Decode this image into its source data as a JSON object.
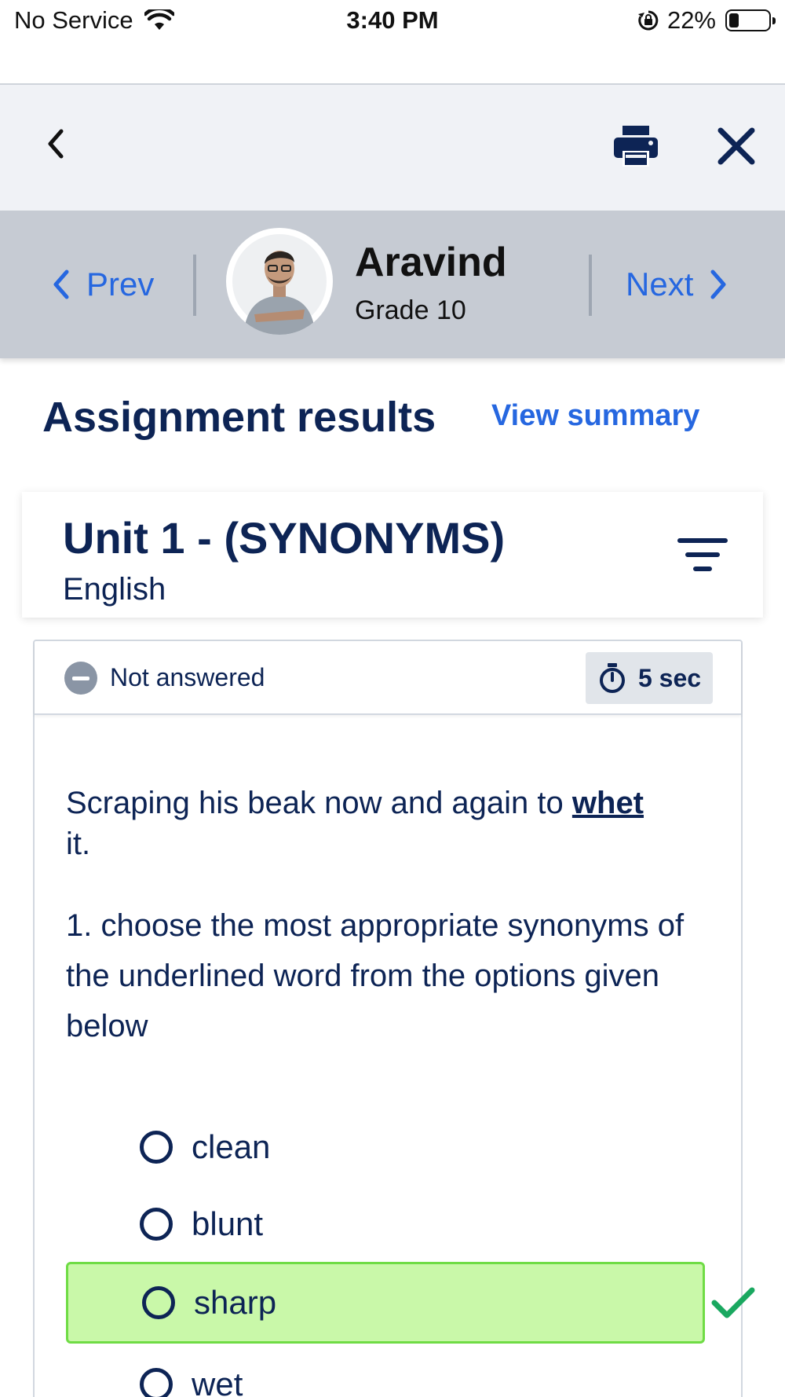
{
  "status_bar": {
    "carrier": "No Service",
    "time": "3:40 PM",
    "battery": "22%",
    "battery_level": 0.22
  },
  "student": {
    "prev_label": "Prev",
    "next_label": "Next",
    "name": "Aravind",
    "grade": "Grade 10"
  },
  "page": {
    "title": "Assignment results",
    "view_summary": "View summary"
  },
  "unit": {
    "title": "Unit 1 - (SYNONYMS)",
    "subject": "English"
  },
  "question": {
    "status": "Not answered",
    "time": "5 sec",
    "passage_before": "Scraping his beak now and again to ",
    "passage_word": "whet ",
    "passage_after": "it.",
    "prompt": "1. choose the most appropriate synonyms of the underlined word from the options given below",
    "options": [
      {
        "label": "clean",
        "correct": false
      },
      {
        "label": "blunt",
        "correct": false
      },
      {
        "label": "sharp",
        "correct": true
      },
      {
        "label": "wet",
        "correct": false
      }
    ]
  },
  "colors": {
    "accent_blue": "#2667e0",
    "navy_text": "#0d2455",
    "correct_bg": "#c9f8a9",
    "correct_border": "#6fdc45",
    "check_green": "#1aa860"
  },
  "icons": [
    "wifi-icon",
    "orientation-lock-icon",
    "battery-icon",
    "chevron-left-icon",
    "printer-icon",
    "close-icon",
    "chevron-right-icon",
    "filter-icon",
    "minus-circle-icon",
    "stopwatch-icon",
    "checkmark-icon"
  ]
}
